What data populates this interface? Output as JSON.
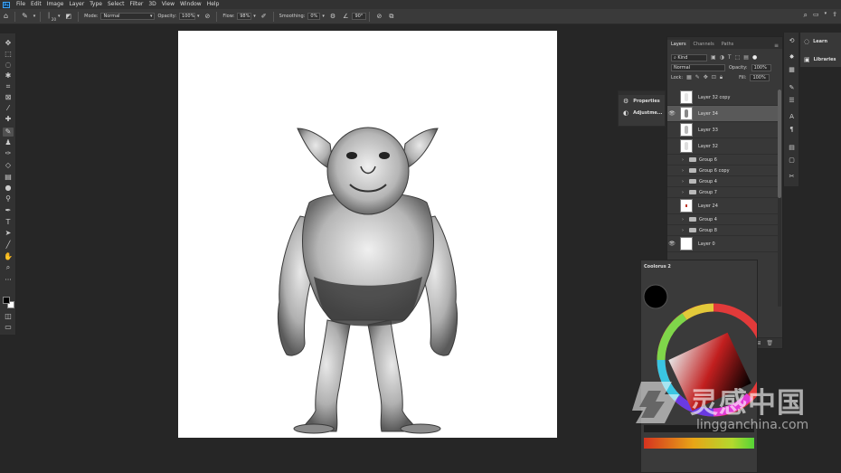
{
  "app": {
    "name": "Adobe Photoshop",
    "logo_text": "Ps"
  },
  "menu": [
    "File",
    "Edit",
    "Image",
    "Layer",
    "Type",
    "Select",
    "Filter",
    "3D",
    "View",
    "Window",
    "Help"
  ],
  "options_bar": {
    "brush_size": "20",
    "mode_label": "Mode:",
    "mode_value": "Normal",
    "opacity_label": "Opacity:",
    "opacity_value": "100%",
    "flow_label": "Flow:",
    "flow_value": "98%",
    "smoothing_label": "Smoothing:",
    "smoothing_value": "0%",
    "angle_value": "90°"
  },
  "properties_panel": {
    "properties_label": "Properties",
    "adjustments_label": "Adjustme..."
  },
  "layers_panel": {
    "tabs": [
      "Layers",
      "Channels",
      "Paths"
    ],
    "filter_value": "Kind",
    "blend_mode": "Normal",
    "opacity_label": "Opacity:",
    "opacity_value": "100%",
    "lock_label": "Lock:",
    "fill_label": "Fill:",
    "fill_value": "100%",
    "layers": [
      {
        "name": "Layer 32 copy",
        "visible": false,
        "type": "layer",
        "selected": false
      },
      {
        "name": "Layer 34",
        "visible": true,
        "type": "layer",
        "selected": true
      },
      {
        "name": "Layer 33",
        "visible": false,
        "type": "layer",
        "selected": false
      },
      {
        "name": "Layer 32",
        "visible": false,
        "type": "layer",
        "selected": false
      },
      {
        "name": "Group 6",
        "visible": false,
        "type": "group",
        "selected": false
      },
      {
        "name": "Group 6 copy",
        "visible": false,
        "type": "group",
        "selected": false
      },
      {
        "name": "Group 4",
        "visible": false,
        "type": "group",
        "selected": false
      },
      {
        "name": "Group 7",
        "visible": false,
        "type": "group",
        "selected": false
      },
      {
        "name": "Layer 24",
        "visible": false,
        "type": "layer",
        "selected": false
      },
      {
        "name": "Group 4",
        "visible": false,
        "type": "group",
        "selected": false
      },
      {
        "name": "Group 8",
        "visible": false,
        "type": "group",
        "selected": false
      },
      {
        "name": "Layer 0",
        "visible": true,
        "type": "layer",
        "selected": false
      }
    ]
  },
  "right_dock": {
    "learn_label": "Learn",
    "libraries_label": "Libraries"
  },
  "coolorus": {
    "title": "Coolorus 2"
  },
  "watermark": {
    "chinese": "灵感中国",
    "url": "lingganchina.com"
  },
  "colors": {
    "foreground": "#000000",
    "background": "#ffffff",
    "panel": "#383838",
    "workspace": "#262626"
  }
}
